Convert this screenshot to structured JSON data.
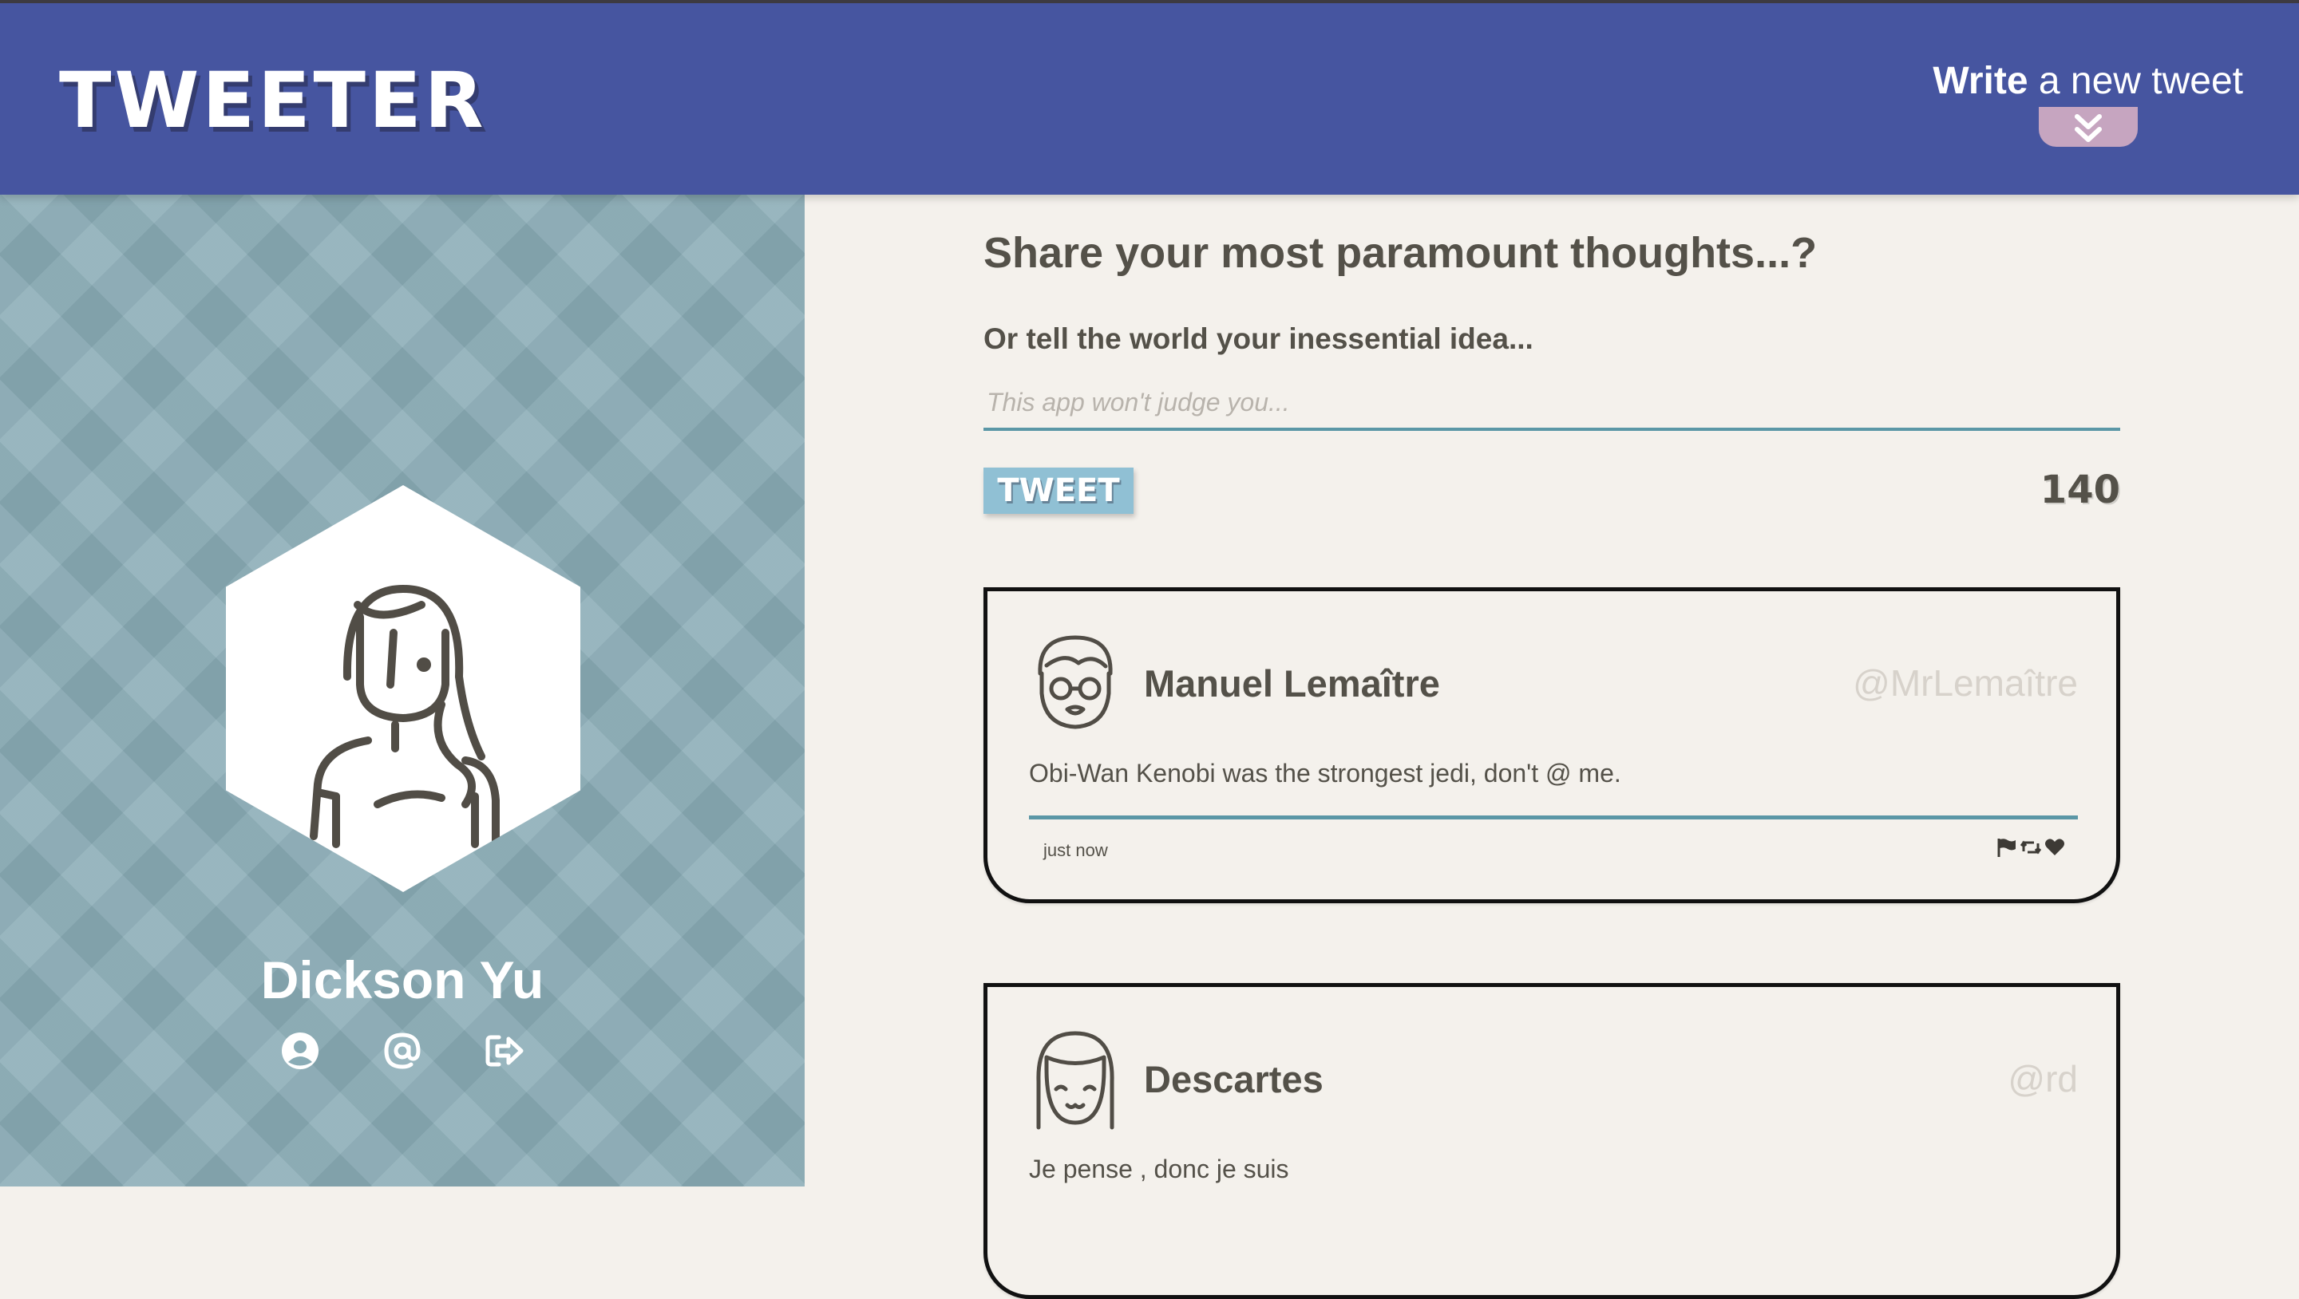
{
  "header": {
    "brand": "TWEETER",
    "compose_toggle": {
      "bold": "Write",
      "rest": " a new tweet",
      "icon": "double-chevron-down-icon"
    }
  },
  "sidebar": {
    "user_name": "Dickson Yu",
    "icons": [
      "user-circle-icon",
      "at-icon",
      "sign-out-icon"
    ]
  },
  "compose": {
    "title": "Share your most paramount thoughts...?",
    "label": "Or tell the world your inessential idea...",
    "placeholder": "This app won't judge you...",
    "button_label": "TWEET",
    "counter": "140"
  },
  "tweets": [
    {
      "name": "Manuel Lemaître",
      "handle": "@MrLemaître",
      "text": "Obi-Wan Kenobi was the strongest jedi, don't @ me.",
      "time": "just now",
      "actions": [
        "flag-icon",
        "retweet-icon",
        "heart-icon"
      ]
    },
    {
      "name": "Descartes",
      "handle": "@rd",
      "text": "Je pense , donc je suis"
    }
  ],
  "colors": {
    "header": "#4655a0",
    "sidebar": "#8aacb6",
    "background": "#f4f1ec",
    "accent_rule": "#5b97a6",
    "tweet_button": "#90c0d4",
    "toggle_button": "#c6a5c0",
    "text": "#545149"
  }
}
